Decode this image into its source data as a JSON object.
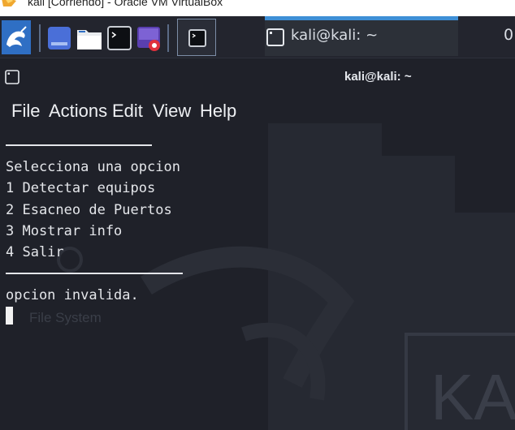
{
  "host_window": {
    "title": "kali [Corriendo] - Oracle VM VirtualBox"
  },
  "panel": {
    "launchers": [
      "kali-menu-icon",
      "show-desktop-icon",
      "file-manager-icon",
      "terminal-emulator-icon",
      "screen-recorder-icon"
    ],
    "workspace_icon": "terminal-icon",
    "task_label": "kali@kali: ~",
    "clock_partial": "0",
    "accent_color": "#3e8fd6"
  },
  "terminal": {
    "title": "kali@kali: ~",
    "menu": [
      "File",
      "Actions",
      "Edit",
      "View",
      "Help"
    ],
    "lines": [
      "Selecciona una opcion",
      "1 Detectar equipos",
      "2 Esacneo de Puertos",
      "3 Mostrar info",
      "4 Salir"
    ],
    "message": "opcion invalida.",
    "background_color": "#1f2129",
    "text_color": "#e4e6ea"
  },
  "desktop_background": {
    "icon_label": "File System",
    "watermark": "KA"
  }
}
